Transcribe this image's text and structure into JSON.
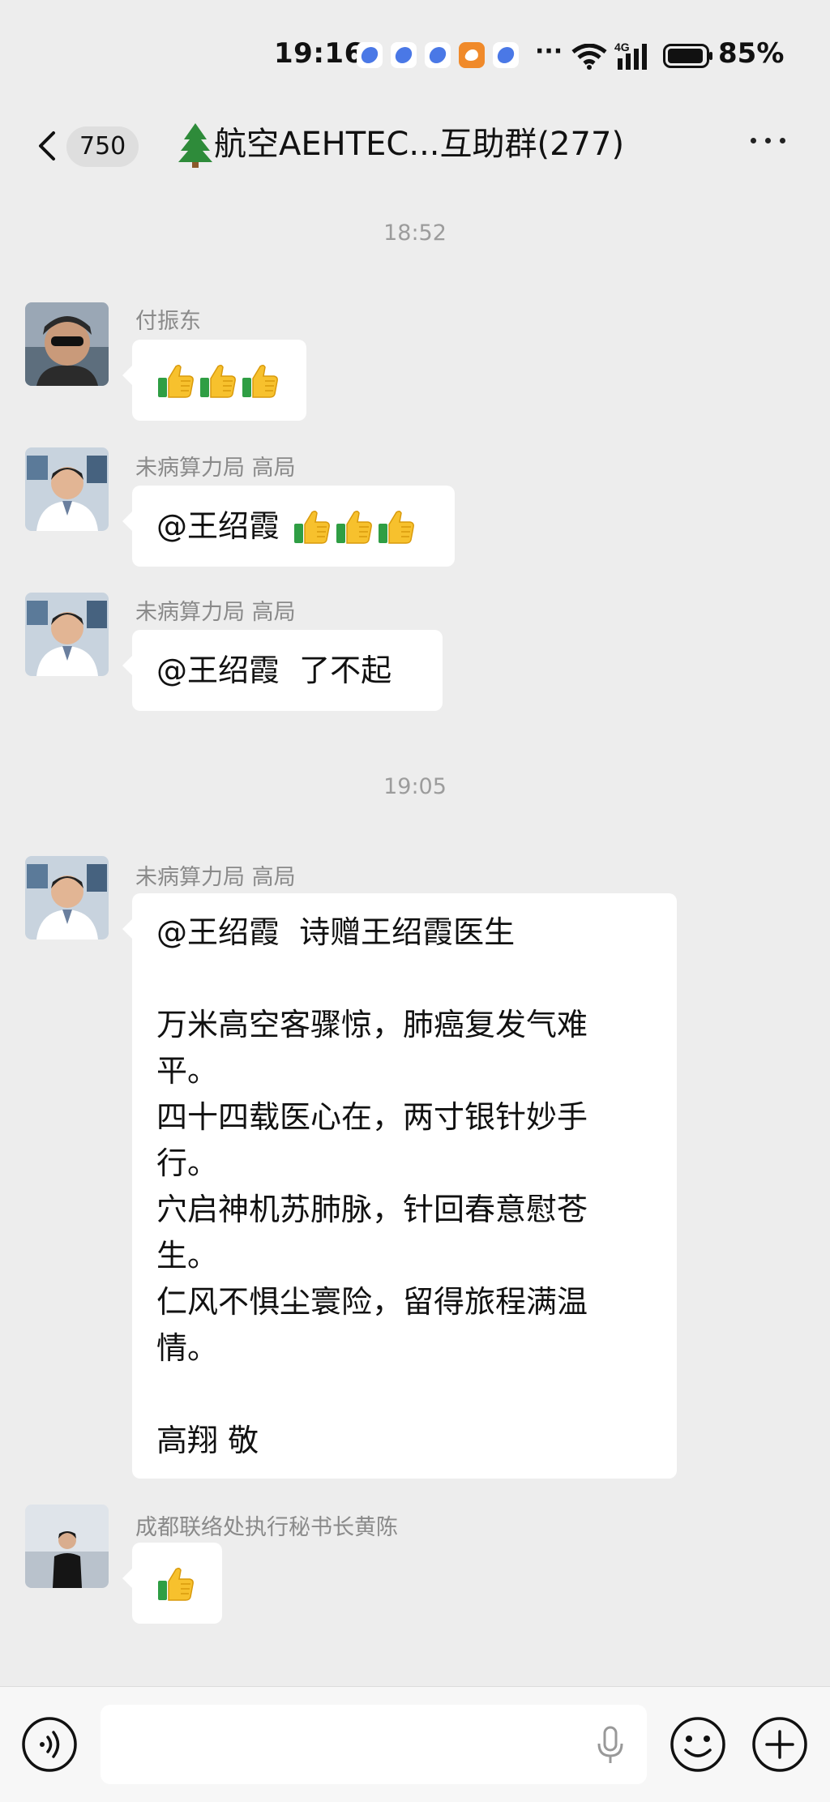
{
  "status_bar": {
    "time": "19:16",
    "ellipsis": "···",
    "network": "4G",
    "battery": "85%"
  },
  "header": {
    "back_icon": "chevron-left-icon",
    "unread_count": "750",
    "title": "航空AEHTEC...互助群(277)",
    "title_emoji": "christmas-tree-icon",
    "more_icon": "more-dots-icon"
  },
  "messages": {
    "time_1": "18:52",
    "time_2": "19:05",
    "m1": {
      "sender": "付振东",
      "content": "thumbs-up x3"
    },
    "m2": {
      "sender": "未病算力局 高局",
      "text": "@王绍霞 ",
      "content": "thumbs-up x3"
    },
    "m3": {
      "sender": "未病算力局 高局",
      "text": "@王绍霞  了不起"
    },
    "m4": {
      "sender": "未病算力局 高局",
      "lines": [
        "@王绍霞  诗赠王绍霞医生",
        "",
        "万米高空客骤惊，肺癌复发气难",
        "平。",
        "四十四载医心在，两寸银针妙手",
        "行。",
        "穴启神机苏肺脉，针回春意慰苍",
        "生。",
        "仁风不惧尘寰险，留得旅程满温",
        "情。",
        "",
        "高翔 敬"
      ]
    },
    "m5": {
      "sender": "成都联络处执行秘书长黄陈",
      "content": "thumbs-up x1"
    }
  },
  "input_bar": {
    "voice_icon": "voice-mode-icon",
    "mic_icon": "microphone-icon",
    "emoji_icon": "emoji-icon",
    "plus_icon": "plus-icon",
    "value": ""
  },
  "colors": {
    "background": "#ededed",
    "bubble": "#ffffff",
    "sender_text": "#8a8a8a",
    "timestamp": "#9c9c9c"
  }
}
